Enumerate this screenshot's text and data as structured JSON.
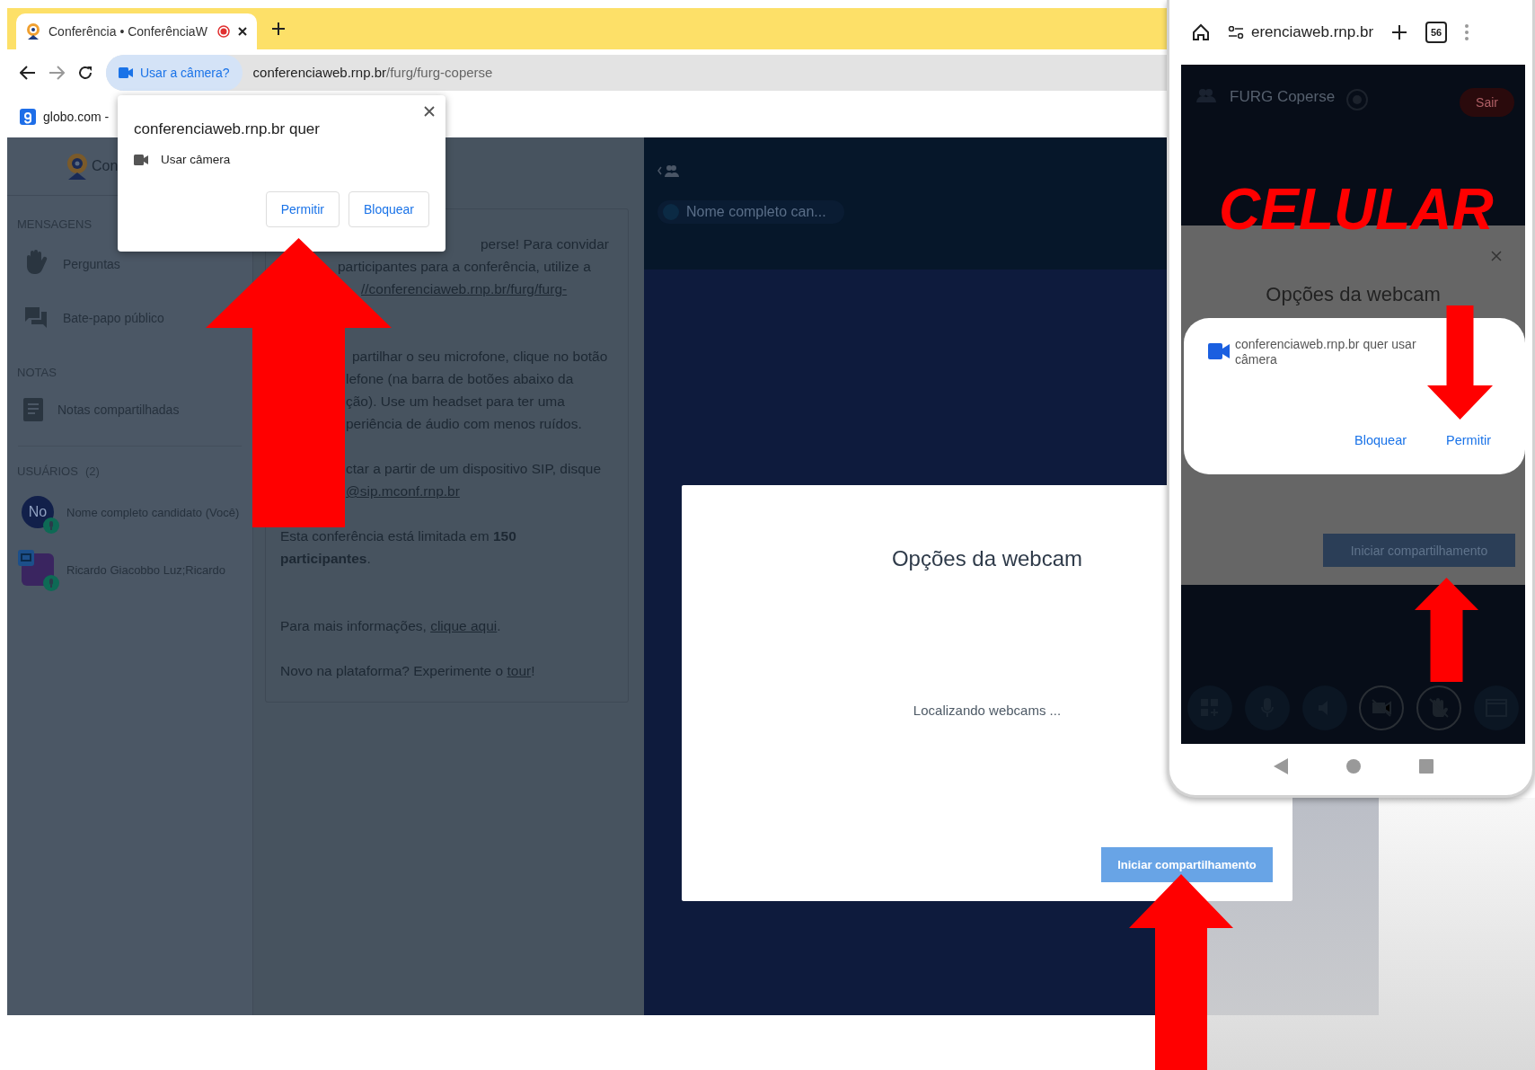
{
  "browser": {
    "tab": {
      "title": "Conferência • ConferênciaW"
    },
    "address_bar": {
      "permission_chip": "Usar a câmera?",
      "url_host": "conferenciaweb.rnp.br",
      "url_path": "/furg/furg-coperse"
    },
    "bookmarks": [
      "globo.com -"
    ]
  },
  "permission_popup": {
    "title": "conferenciaweb.rnp.br quer",
    "permission": "Usar câmera",
    "buttons": [
      "Permitir",
      "Bloquear"
    ]
  },
  "sidebar": {
    "brand": "Con",
    "sections": [
      {
        "title": "MENSAGENS",
        "items": [
          {
            "label": "Perguntas",
            "kind": "questions"
          },
          {
            "label": "Bate-papo público",
            "kind": "chat"
          }
        ]
      },
      {
        "title": "NOTAS",
        "items": [
          {
            "label": "Notas compartilhadas",
            "kind": "notes"
          }
        ]
      }
    ],
    "users_title": "USUÁRIOS",
    "users_count": "(2)",
    "users": [
      {
        "name": "Nome completo candidato (Você)",
        "kind": "initials",
        "avatar": "No"
      },
      {
        "name": "Ricardo Giacobbo Luz;Ricardo",
        "kind": "picture"
      }
    ]
  },
  "welcome": {
    "paragraphs": [
      {
        "lines": [
          {
            "text": "perse! Para convidar"
          },
          {
            "text": "participantes para a conferência, utilize a"
          },
          {
            "link": "//conferenciaweb.rnp.br/furg/furg-"
          }
        ]
      },
      {
        "lines": [
          {
            "text": "partilhar o seu microfone, clique no botão"
          },
          {
            "text": "lefone (na barra de botões abaixo da"
          },
          {
            "text": "ção). Use um headset para ter uma"
          },
          {
            "text": "periência de áudio com menos ruídos."
          }
        ]
      },
      {
        "lines": [
          {
            "text": "ctar a partir de um dispositivo SIP, disque"
          },
          {
            "link": "@sip.mconf.rnp.br"
          }
        ]
      },
      {
        "lines": [
          {
            "text": "Esta conferência está limitada em **150 participantes**."
          }
        ]
      },
      {
        "lines": [
          {
            "text": "Para mais informações, ",
            "link": "clique aqui",
            "after": "."
          }
        ]
      },
      {
        "lines": [
          {
            "text": "Novo na plataforma? Experimente o ",
            "link": "tour",
            "after": "!"
          }
        ]
      }
    ]
  },
  "main": {
    "user_pill": "Nome completo can..."
  },
  "webcam_dialog": {
    "title": "Opções da webcam",
    "status": "Localizando webcams ...",
    "button": "Iniciar compartilhamento"
  },
  "phone": {
    "url": "erenciaweb.rnp.br",
    "tab_count": "56",
    "room": "FURG Coperse",
    "leave": "Sair",
    "dialog_title": "Opções da webcam",
    "prompt_lines": [
      "conferenciaweb.rnp.br quer usar",
      "câmera"
    ],
    "buttons": [
      "Bloquear",
      "Permitir"
    ],
    "share_button": "Iniciar compartilhamento"
  },
  "annotation_label": "CELULAR"
}
